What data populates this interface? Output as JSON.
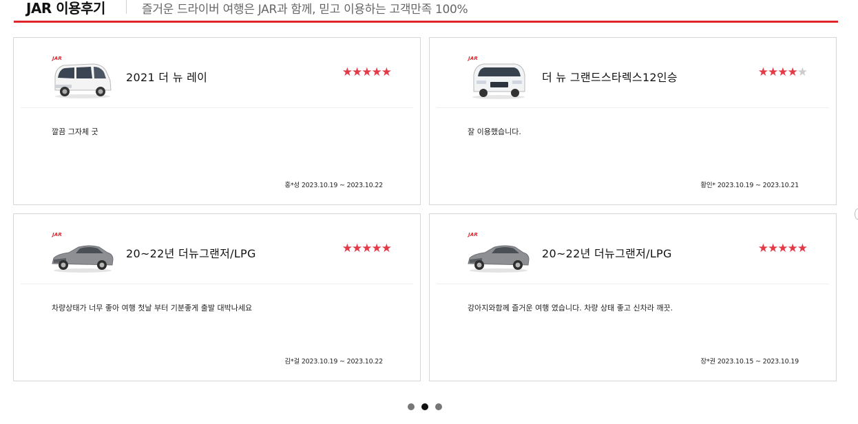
{
  "header": {
    "title": "JAR 이용후기",
    "subtitle": "즐거운 드라이버 여행은 JAR과 함께, 믿고 이용하는 고객만족 100%"
  },
  "reviews": [
    {
      "logo": "JAR",
      "car_name": "2021 더 뉴 레이",
      "car_icon": "white-boxy-minicar",
      "rating": 5,
      "comment": "깔끔 그자체 굿",
      "reviewer": "홍*성",
      "period": "2023.10.19 ~ 2023.10.22"
    },
    {
      "logo": "JAR",
      "car_name": "더 뉴 그랜드스타렉스12인승",
      "car_icon": "white-van",
      "rating": 4,
      "comment": "잘 이용했습니다.",
      "reviewer": "황인*",
      "period": "2023.10.19 ~ 2023.10.21"
    },
    {
      "logo": "JAR",
      "car_name": "20~22년 더뉴그랜저/LPG",
      "car_icon": "gray-sedan",
      "rating": 5,
      "comment": "차량상태가 너무 좋아 여행 첫날 부터 기분좋게 출발 대박나세요",
      "reviewer": "김*걸",
      "period": "2023.10.19 ~ 2023.10.22"
    },
    {
      "logo": "JAR",
      "car_name": "20~22년 더뉴그랜저/LPG",
      "car_icon": "gray-sedan",
      "rating": 5,
      "comment": "강아지와함께 즐거운 여행 였습니다. 차량 상태 좋고 신차라 깨끗.",
      "reviewer": "장*권",
      "period": "2023.10.15 ~ 2023.10.19"
    }
  ],
  "pagination": {
    "pages": 3,
    "active": 2
  },
  "colors": {
    "accent": "#e0262b",
    "star": "#e33a48",
    "star_empty": "#cccccc"
  }
}
